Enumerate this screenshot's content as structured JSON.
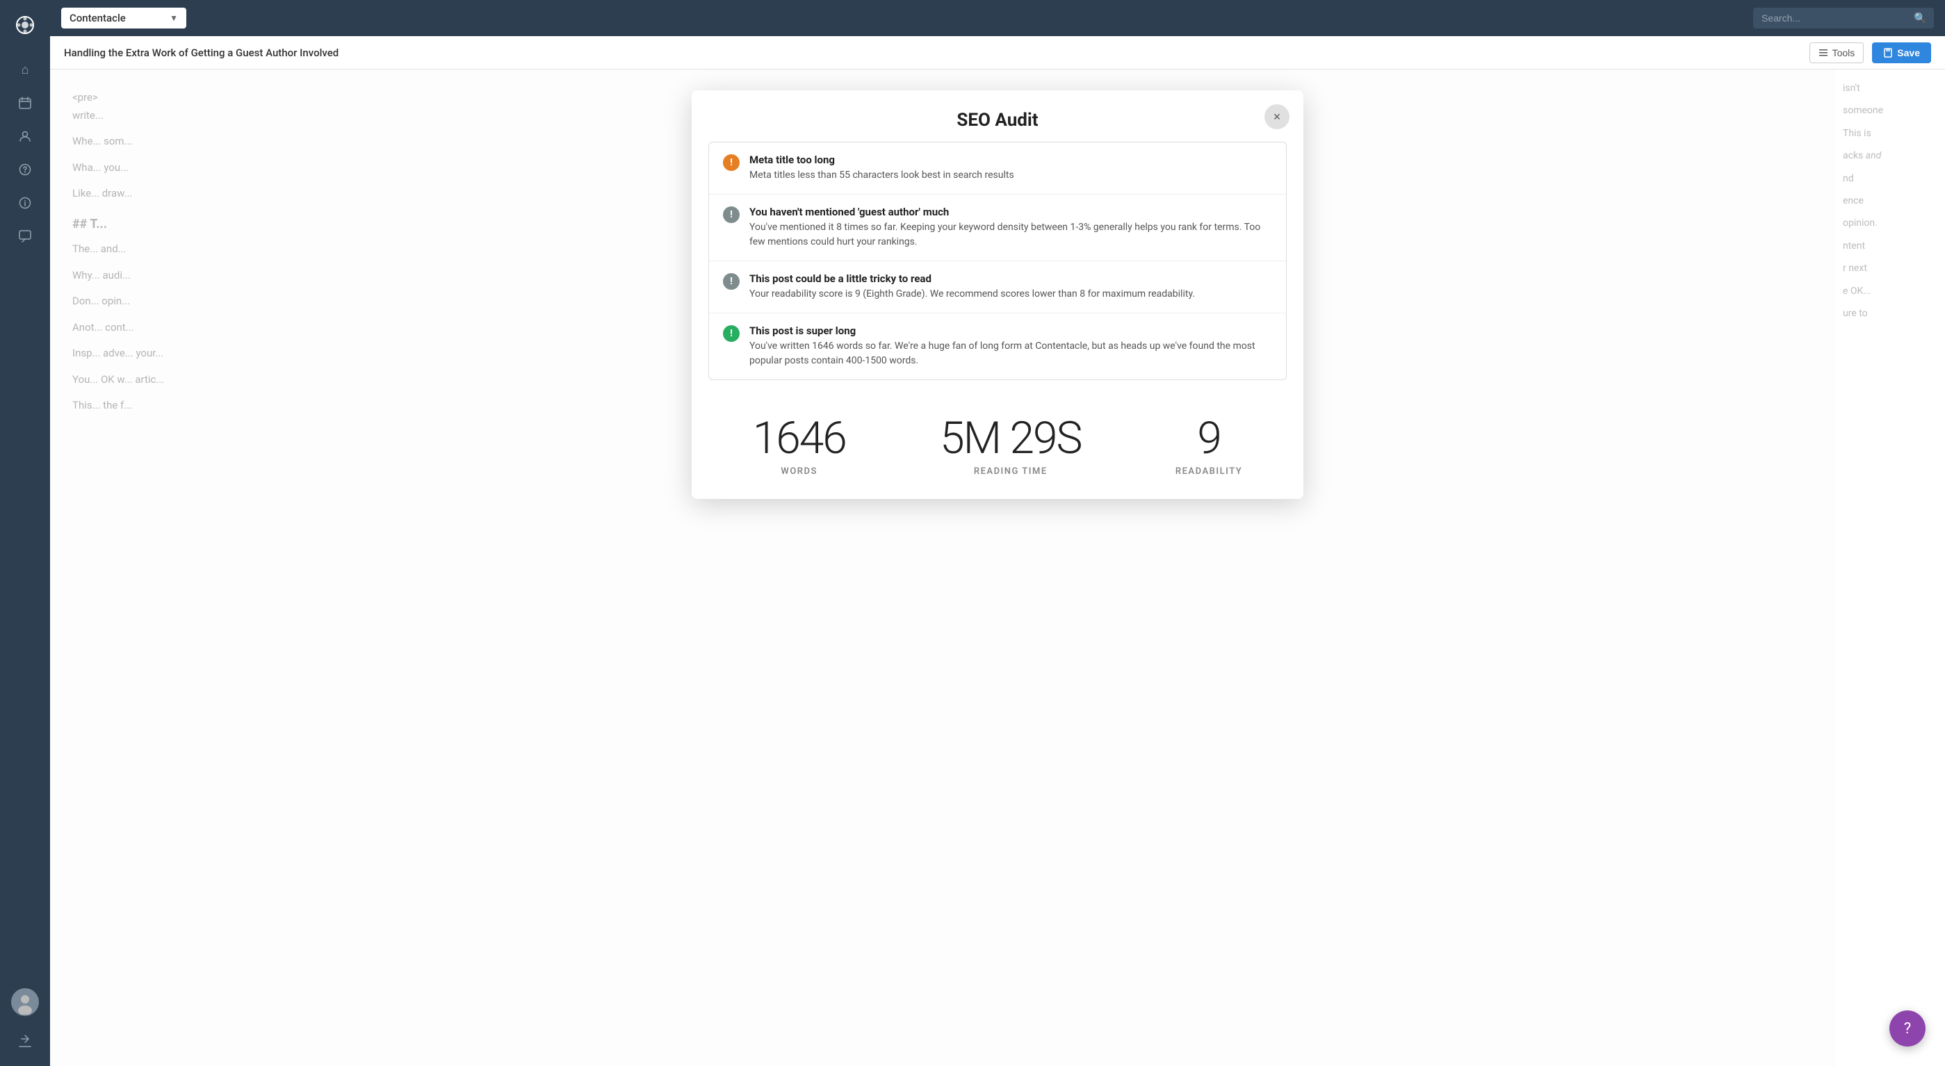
{
  "app": {
    "brand": "Contentacle",
    "search_placeholder": "Search..."
  },
  "sidebar": {
    "items": [
      {
        "name": "home-icon",
        "icon": "⌂",
        "label": "Home"
      },
      {
        "name": "calendar-icon",
        "icon": "📅",
        "label": "Calendar"
      },
      {
        "name": "users-icon",
        "icon": "👥",
        "label": "Users"
      },
      {
        "name": "help-icon",
        "icon": "?",
        "label": "Help"
      },
      {
        "name": "info-icon",
        "icon": "ℹ",
        "label": "Info"
      },
      {
        "name": "comments-icon",
        "icon": "💬",
        "label": "Comments"
      },
      {
        "name": "export-icon",
        "icon": "↗",
        "label": "Export"
      }
    ]
  },
  "editor": {
    "title": "Handling the Extra Work of Getting a Guest Author Involved",
    "tools_label": "Tools",
    "save_label": "Save",
    "content_lines": [
      "<pre> write...",
      "Whe... som...",
      "Wha... you...",
      "Like... draw...",
      "## T...",
      "The... and...",
      "Why... audi...",
      "Don... opin...",
      "Anot... cont...",
      "Insp... adve... your...",
      "You... OK w... artic...",
      "This... the f..."
    ],
    "right_content": [
      "isn't",
      "someone",
      "This is",
      "acks and",
      "nd",
      "ence",
      "opinion.",
      "ntent",
      "r next",
      "e OK...",
      "ure to"
    ]
  },
  "modal": {
    "title": "SEO Audit",
    "close_label": "×",
    "audit_items": [
      {
        "icon_type": "orange",
        "icon_symbol": "!",
        "title": "Meta title too long",
        "description": "Meta titles less than 55 characters look best in search results"
      },
      {
        "icon_type": "gray",
        "icon_symbol": "!",
        "title": "You haven't mentioned 'guest author' much",
        "description": "You've mentioned it 8 times so far. Keeping your keyword density between 1-3% generally helps you rank for terms. Too few mentions could hurt your rankings."
      },
      {
        "icon_type": "gray",
        "icon_symbol": "!",
        "title": "This post could be a little tricky to read",
        "description": "Your readability score is 9 (Eighth Grade). We recommend scores lower than 8 for maximum readability."
      },
      {
        "icon_type": "green",
        "icon_symbol": "!",
        "title": "This post is super long",
        "description": "You've written 1646 words so far. We're a huge fan of long form at Contentacle, but as heads up we've found the most popular posts contain 400-1500 words."
      }
    ],
    "stats": [
      {
        "value": "1646",
        "label": "WORDS"
      },
      {
        "value": "5M 29S",
        "label": "READING TIME"
      },
      {
        "value": "9",
        "label": "READABILITY"
      }
    ]
  },
  "chat_bubble": {
    "icon": "?",
    "label": "Chat support"
  }
}
